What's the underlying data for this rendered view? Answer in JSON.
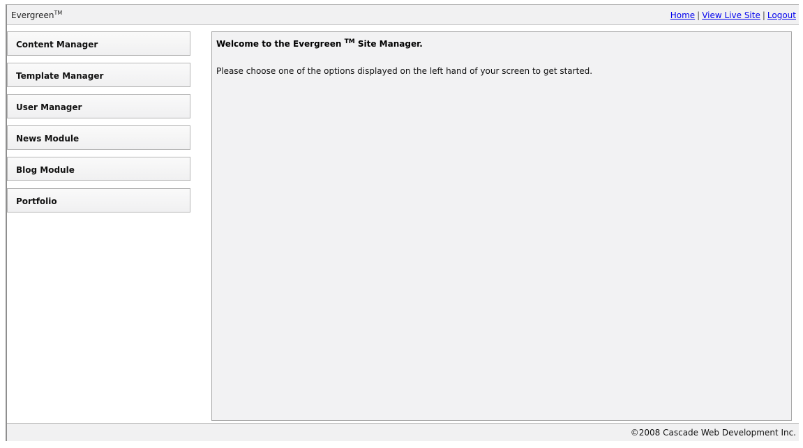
{
  "header": {
    "brand": "Evergreen",
    "brand_mark": "TM",
    "links": {
      "home": "Home",
      "view_live_site": "View Live Site",
      "logout": "Logout",
      "separator": "|"
    }
  },
  "sidebar": {
    "items": [
      {
        "label": "Content Manager"
      },
      {
        "label": "Template Manager"
      },
      {
        "label": "User Manager"
      },
      {
        "label": "News Module"
      },
      {
        "label": "Blog Module"
      },
      {
        "label": "Portfolio"
      }
    ]
  },
  "main": {
    "welcome_prefix": "Welcome to the Evergreen ",
    "welcome_mark": "TM",
    "welcome_suffix": " Site Manager.",
    "intro": "Please choose one of the options displayed on the left hand of your screen to get started."
  },
  "footer": {
    "copyright": "©2008 Cascade Web Development Inc."
  },
  "colors": {
    "panel_bg": "#f2f2f3",
    "link": "#0000ee",
    "border": "#a9a9a9"
  }
}
